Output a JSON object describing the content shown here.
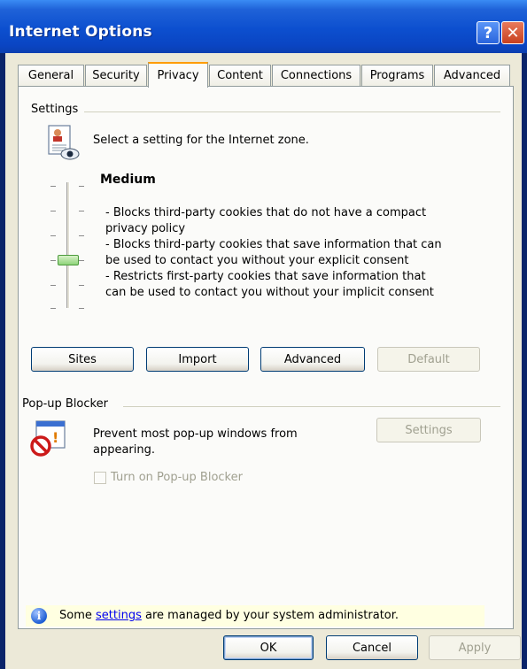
{
  "window": {
    "title": "Internet Options"
  },
  "titlebar_buttons": {
    "help": "?",
    "close": "✕"
  },
  "tabs": [
    "General",
    "Security",
    "Privacy",
    "Content",
    "Connections",
    "Programs",
    "Advanced"
  ],
  "active_tab": "Privacy",
  "settings": {
    "group_title": "Settings",
    "zone_text": "Select a setting for the Internet zone.",
    "level_title": "Medium",
    "description": [
      "- Blocks third-party cookies that do not have a compact",
      "privacy policy",
      "- Blocks third-party cookies that save information that can",
      "be used to contact you without your explicit consent",
      "- Restricts first-party cookies that save information that",
      "can be used to contact you without your implicit consent"
    ],
    "slider_level": "3 of 6",
    "buttons": {
      "sites": "Sites",
      "import": "Import",
      "advanced": "Advanced",
      "default": "Default"
    }
  },
  "popup_blocker": {
    "group_title": "Pop-up Blocker",
    "text_line1": "Prevent most pop-up windows from",
    "text_line2": "appearing.",
    "settings_button": "Settings",
    "checkbox_label": "Turn on Pop-up Blocker",
    "checkbox_checked": false
  },
  "info": {
    "prefix": "Some ",
    "link": "settings",
    "suffix": " are managed by your system administrator."
  },
  "footer": {
    "ok": "OK",
    "cancel": "Cancel",
    "apply": "Apply"
  },
  "colors": {
    "title_bar": "#0c4fcf",
    "dialog_bg": "#ece9d8",
    "panel_bg": "#fbfbf9",
    "active_tab_accent": "#ff9c00",
    "info_bar": "#ffffe1",
    "link": "#0000ee"
  },
  "icons": [
    "help-icon",
    "close-icon",
    "privacy-zone-icon",
    "popup-blocker-icon",
    "info-icon"
  ]
}
